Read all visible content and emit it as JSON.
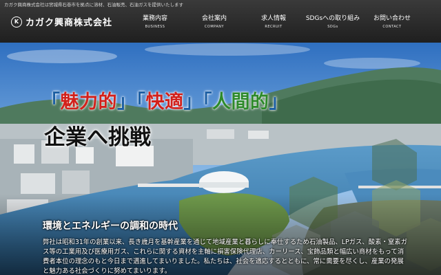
{
  "tagline": "カガク興商株式会社は宮城県石巻市を拠点に溶材、石油販売、石油ガスを提供いたします",
  "brand": {
    "name": "カガク興商株式会社",
    "mark": "K"
  },
  "nav": [
    {
      "jp": "業務内容",
      "en": "BUSINESS"
    },
    {
      "jp": "会社案内",
      "en": "COMPANY"
    },
    {
      "jp": "求人情報",
      "en": "RECRUIT"
    },
    {
      "jp": "SDGsへの取り組み",
      "en": "SDGs"
    },
    {
      "jp": "お問い合わせ",
      "en": "CONTACT"
    }
  ],
  "hero": {
    "slogan": [
      {
        "open": "「",
        "word": "魅力的",
        "close": "」"
      },
      {
        "open": "「",
        "word": "快適",
        "close": "」"
      },
      {
        "open": "「",
        "word": "人間的",
        "close": "」"
      }
    ],
    "headline": "企業へ挑戦",
    "subtitle": "環境とエネルギーの調和の時代",
    "body": "弊社は昭和31年の創業以来、長き歳月を基幹産業を通じて地域産業と暮らしに奉仕するため石油製品、LPガス、酸素・窒素ガス等の工業用及び医療用ガス、これらに関する資材を主軸に損害保険代理店、カーリース、宝飾品類と幅広い商材をもって消費者本位の理念のもと今日まで邁進してまいりました。私たちは、社会を適応するとともに、常に需要を尽くし、産業の発展と魅力ある社会づくりに努めてまいります。"
  },
  "colors": {
    "red": "#d2211b",
    "blue": "#1c6fb4",
    "green": "#2d8a2a"
  }
}
